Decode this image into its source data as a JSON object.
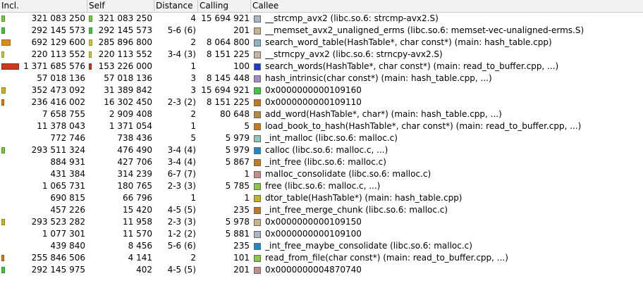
{
  "columns": {
    "incl": "Incl.",
    "self": "Self",
    "distance": "Distance",
    "calling": "Calling",
    "callee": "Callee"
  },
  "rows": [
    {
      "incl": "321 083 250",
      "self": "321 083 250",
      "distance": "4",
      "calling": "15 694 921",
      "callee": "__strcmp_avx2 (libc.so.6: strcmp-avx2.S)",
      "swatch": "#a9b8c8",
      "inclColor": "#78c83c",
      "inclFrac": 0.02,
      "selfColor": "#78c83c",
      "selfFrac": 0.02
    },
    {
      "incl": "292 145 573",
      "self": "292 145 573",
      "distance": "5-6 (6)",
      "calling": "201",
      "callee": "__memset_avx2_unaligned_erms (libc.so.6: memset-vec-unaligned-erms.S)",
      "swatch": "#c9b48c",
      "inclColor": "#3cc83c",
      "inclFrac": 0.02,
      "selfColor": "#3cc83c",
      "selfFrac": 0.02
    },
    {
      "incl": "692 129 600",
      "self": "285 896 800",
      "distance": "2",
      "calling": "8 064 800",
      "callee": "search_word_table(HashTable*, char const*) (main: hash_table.cpp)",
      "swatch": "#8cb4c8",
      "inclColor": "#d88c1c",
      "inclFrac": 0.05,
      "selfColor": "#c8c83c",
      "selfFrac": 0.02
    },
    {
      "incl": "220 113 552",
      "self": "220 113 552",
      "distance": "3-4 (3)",
      "calling": "8 151 225",
      "callee": "__strncpy_avx2 (libc.so.6: strncpy-avx2.S)",
      "swatch": "#c8b4a0",
      "inclColor": "#c8c83c",
      "inclFrac": 0.014,
      "selfColor": "#c8c83c",
      "selfFrac": 0.014
    },
    {
      "incl": "1 371 685 576",
      "self": "153 226 000",
      "distance": "1",
      "calling": "100",
      "callee": "search_words(HashTable*, char const*) (main: read_to_buffer.cpp, ...)",
      "swatch": "#1c3cc8",
      "inclColor": "#c8381c",
      "inclFrac": 0.1,
      "selfColor": "#c8381c",
      "selfFrac": 0.01
    },
    {
      "incl": "57 018 136",
      "self": "57 018 136",
      "distance": "3",
      "calling": "8 145 448",
      "callee": "hash_intrinsic(char const*) (main: hash_table.cpp, ...)",
      "swatch": "#a08cc8",
      "inclColor": "",
      "inclFrac": 0,
      "selfColor": "",
      "selfFrac": 0
    },
    {
      "incl": "352 473 092",
      "self": "31 389 842",
      "distance": "3",
      "calling": "15 694 921",
      "callee": "0x0000000000109160",
      "swatch": "#3cc83c",
      "inclColor": "#c8b41c",
      "inclFrac": 0.025,
      "selfColor": "",
      "selfFrac": 0
    },
    {
      "incl": "236 416 002",
      "self": "16 302 450",
      "distance": "2-3 (2)",
      "calling": "8 151 225",
      "callee": "0x0000000000109110",
      "swatch": "#c8781c",
      "inclColor": "#d8781c",
      "inclFrac": 0.015,
      "selfColor": "",
      "selfFrac": 0
    },
    {
      "incl": "7 658 755",
      "self": "2 909 408",
      "distance": "2",
      "calling": "80 648",
      "callee": "add_word(HashTable*, char*) (main: hash_table.cpp, ...)",
      "swatch": "#b48c3c",
      "inclColor": "",
      "inclFrac": 0,
      "selfColor": "",
      "selfFrac": 0
    },
    {
      "incl": "11 378 043",
      "self": "1 371 054",
      "distance": "1",
      "calling": "5",
      "callee": "load_book_to_hash(HashTable*, char const*) (main: read_to_buffer.cpp, ...)",
      "swatch": "#c8781c",
      "inclColor": "",
      "inclFrac": 0,
      "selfColor": "",
      "selfFrac": 0
    },
    {
      "incl": "772 746",
      "self": "738 436",
      "distance": "5",
      "calling": "5 979",
      "callee": "_int_malloc (libc.so.6: malloc.c)",
      "swatch": "#8cc8b4",
      "inclColor": "",
      "inclFrac": 0,
      "selfColor": "",
      "selfFrac": 0
    },
    {
      "incl": "293 511 324",
      "self": "476 490",
      "distance": "3-4 (4)",
      "calling": "5 979",
      "callee": "calloc (libc.so.6: malloc.c, ...)",
      "swatch": "#1c8cc8",
      "inclColor": "#78c83c",
      "inclFrac": 0.02,
      "selfColor": "",
      "selfFrac": 0
    },
    {
      "incl": "884 931",
      "self": "427 706",
      "distance": "3-4 (4)",
      "calling": "5 867",
      "callee": "_int_free (libc.so.6: malloc.c)",
      "swatch": "#c8781c",
      "inclColor": "",
      "inclFrac": 0,
      "selfColor": "",
      "selfFrac": 0
    },
    {
      "incl": "431 384",
      "self": "314 239",
      "distance": "6-7 (7)",
      "calling": "1",
      "callee": "malloc_consolidate (libc.so.6: malloc.c)",
      "swatch": "#c88c8c",
      "inclColor": "",
      "inclFrac": 0,
      "selfColor": "",
      "selfFrac": 0
    },
    {
      "incl": "1 065 731",
      "self": "180 765",
      "distance": "2-3 (3)",
      "calling": "5 785",
      "callee": "free (libc.so.6: malloc.c, ...)",
      "swatch": "#8cc83c",
      "inclColor": "",
      "inclFrac": 0,
      "selfColor": "",
      "selfFrac": 0
    },
    {
      "incl": "690 815",
      "self": "66 796",
      "distance": "1",
      "calling": "1",
      "callee": "dtor_table(HashTable*) (main: hash_table.cpp)",
      "swatch": "#c8b41c",
      "inclColor": "",
      "inclFrac": 0,
      "selfColor": "",
      "selfFrac": 0
    },
    {
      "incl": "457 226",
      "self": "15 420",
      "distance": "4-5 (5)",
      "calling": "235",
      "callee": "_int_free_merge_chunk (libc.so.6: malloc.c)",
      "swatch": "#c8781c",
      "inclColor": "",
      "inclFrac": 0,
      "selfColor": "",
      "selfFrac": 0
    },
    {
      "incl": "293 523 282",
      "self": "11 958",
      "distance": "2-3 (3)",
      "calling": "5 978",
      "callee": "0x0000000000109150",
      "swatch": "#c8b48c",
      "inclColor": "#c8b41c",
      "inclFrac": 0.02,
      "selfColor": "",
      "selfFrac": 0
    },
    {
      "incl": "1 077 301",
      "self": "11 570",
      "distance": "1-2 (2)",
      "calling": "5 881",
      "callee": "0x0000000000109100",
      "swatch": "#a8b8c8",
      "inclColor": "",
      "inclFrac": 0,
      "selfColor": "",
      "selfFrac": 0
    },
    {
      "incl": "439 840",
      "self": "8 456",
      "distance": "5-6 (6)",
      "calling": "235",
      "callee": "_int_free_maybe_consolidate (libc.so.6: malloc.c)",
      "swatch": "#1c8cc8",
      "inclColor": "",
      "inclFrac": 0,
      "selfColor": "",
      "selfFrac": 0
    },
    {
      "incl": "255 846 506",
      "self": "4 141",
      "distance": "2",
      "calling": "101",
      "callee": "read_from_file(char const*) (main: read_to_buffer.cpp, ...)",
      "swatch": "#8cc83c",
      "inclColor": "#d8781c",
      "inclFrac": 0.015,
      "selfColor": "",
      "selfFrac": 0
    },
    {
      "incl": "292 145 975",
      "self": "402",
      "distance": "4-5 (5)",
      "calling": "201",
      "callee": "0x0000000004870740",
      "swatch": "#c88c8c",
      "inclColor": "#3cc83c",
      "inclFrac": 0.02,
      "selfColor": "",
      "selfFrac": 0
    }
  ]
}
